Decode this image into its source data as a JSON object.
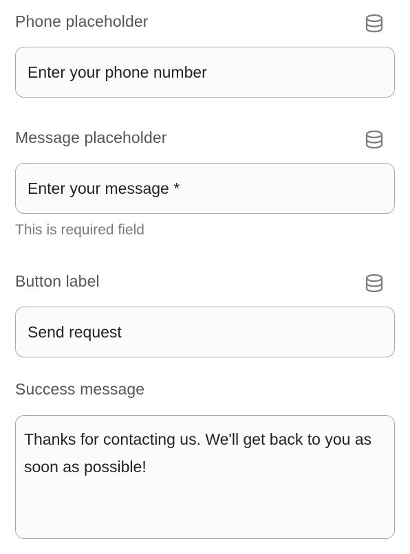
{
  "fields": {
    "phone_placeholder": {
      "label": "Phone placeholder",
      "value": "Enter your phone number",
      "icon": "database-icon"
    },
    "message_placeholder": {
      "label": "Message placeholder",
      "value": "Enter your message *",
      "icon": "database-icon",
      "helper": "This is required field"
    },
    "button_label": {
      "label": "Button label",
      "value": "Send request",
      "icon": "database-icon"
    },
    "success_message": {
      "label": "Success message",
      "value": "Thanks for contacting us. We'll get back to you as soon as possible!"
    }
  },
  "colors": {
    "label": "#555555",
    "helper": "#7a7a7a",
    "border": "#a9a9a9",
    "input_bg": "#fbfbfb",
    "icon": "#7d7d7d"
  }
}
